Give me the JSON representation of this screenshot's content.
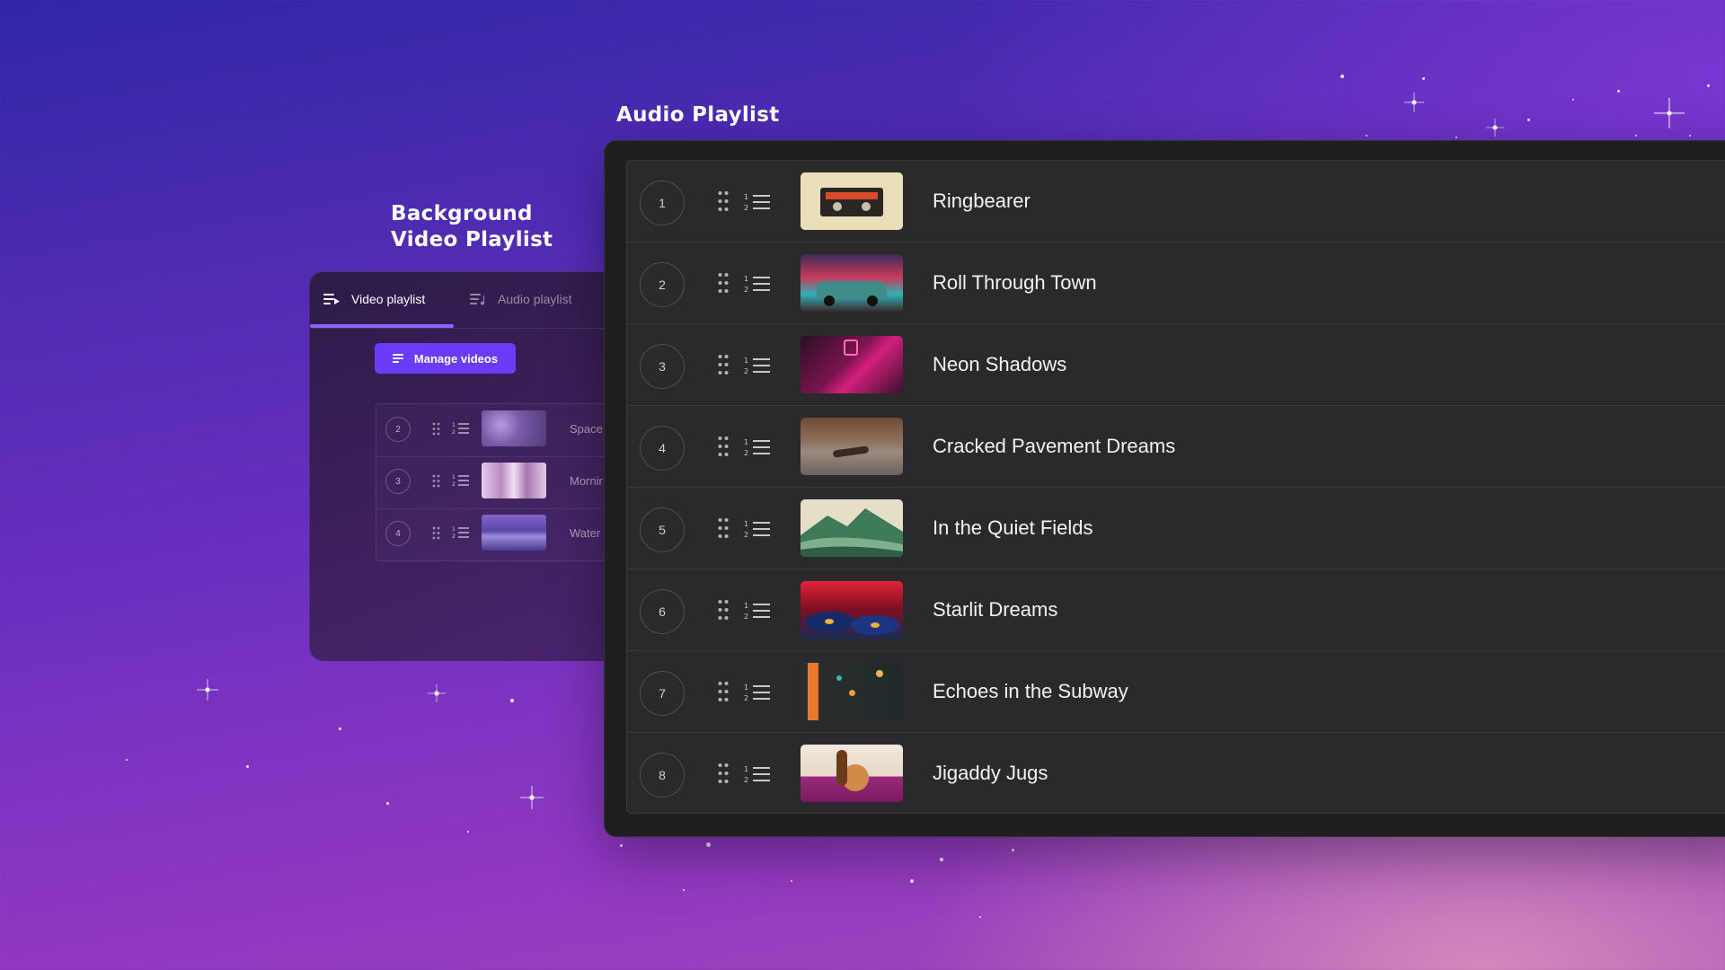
{
  "headings": {
    "audio": "Audio Playlist",
    "video_line1": "Background",
    "video_line2": "Video Playlist"
  },
  "video_panel": {
    "tabs": [
      {
        "label": "Video playlist",
        "icon": "video-list-icon",
        "active": true
      },
      {
        "label": "Audio playlist",
        "icon": "audio-list-icon",
        "active": false
      }
    ],
    "manage_button": "Manage videos",
    "items": [
      {
        "number": "2",
        "title": "Space",
        "thumb": "purple-space"
      },
      {
        "number": "3",
        "title": "Mornir",
        "thumb": "pink-morning"
      },
      {
        "number": "4",
        "title": "Water",
        "thumb": "violet-water"
      }
    ]
  },
  "audio_playlist": {
    "tracks": [
      {
        "number": "1",
        "title": "Ringbearer",
        "thumb": "cassette"
      },
      {
        "number": "2",
        "title": "Roll Through Town",
        "thumb": "retro-car"
      },
      {
        "number": "3",
        "title": "Neon Shadows",
        "thumb": "neon-alley"
      },
      {
        "number": "4",
        "title": "Cracked Pavement Dreams",
        "thumb": "skateboard"
      },
      {
        "number": "5",
        "title": "In the Quiet Fields",
        "thumb": "green-hills"
      },
      {
        "number": "6",
        "title": "Starlit Dreams",
        "thumb": "vinyl-records"
      },
      {
        "number": "7",
        "title": "Echoes in the Subway",
        "thumb": "subway-night"
      },
      {
        "number": "8",
        "title": "Jigaddy Jugs",
        "thumb": "cat-violin"
      }
    ]
  },
  "colors": {
    "accent": "#6a3cf6",
    "tab_underline": "#8b63ff",
    "panel_bg": "#1f1f21",
    "list_bg": "#2a2a2c"
  }
}
